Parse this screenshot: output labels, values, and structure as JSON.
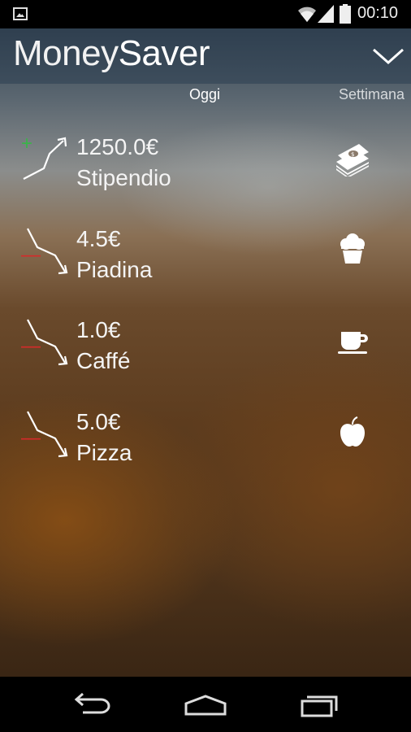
{
  "status_bar": {
    "time": "00:10",
    "icons": [
      "gallery-icon",
      "wifi-icon",
      "signal-icon",
      "battery-icon"
    ]
  },
  "app_bar": {
    "title_light": "Money",
    "title_bold": "Saver",
    "menu_icon": "chevron-down-icon"
  },
  "tabs": {
    "active": "Oggi",
    "next": "Settimana"
  },
  "entries": [
    {
      "sign": "+",
      "amount": "1250.0€",
      "label": "Stipendio",
      "type": "income",
      "icon": "money-stack-icon"
    },
    {
      "sign": "—",
      "amount": "4.5€",
      "label": "Piadina",
      "type": "expense",
      "icon": "cupcake-icon"
    },
    {
      "sign": "—",
      "amount": "1.0€",
      "label": "Caffé",
      "type": "expense",
      "icon": "coffee-cup-icon"
    },
    {
      "sign": "—",
      "amount": "5.0€",
      "label": "Pizza",
      "type": "expense",
      "icon": "apple-icon"
    }
  ],
  "colors": {
    "income": "#3bb34a",
    "expense": "#d52a2a"
  },
  "nav_bar": {
    "buttons": [
      "back-icon",
      "home-icon",
      "recent-apps-icon"
    ]
  }
}
